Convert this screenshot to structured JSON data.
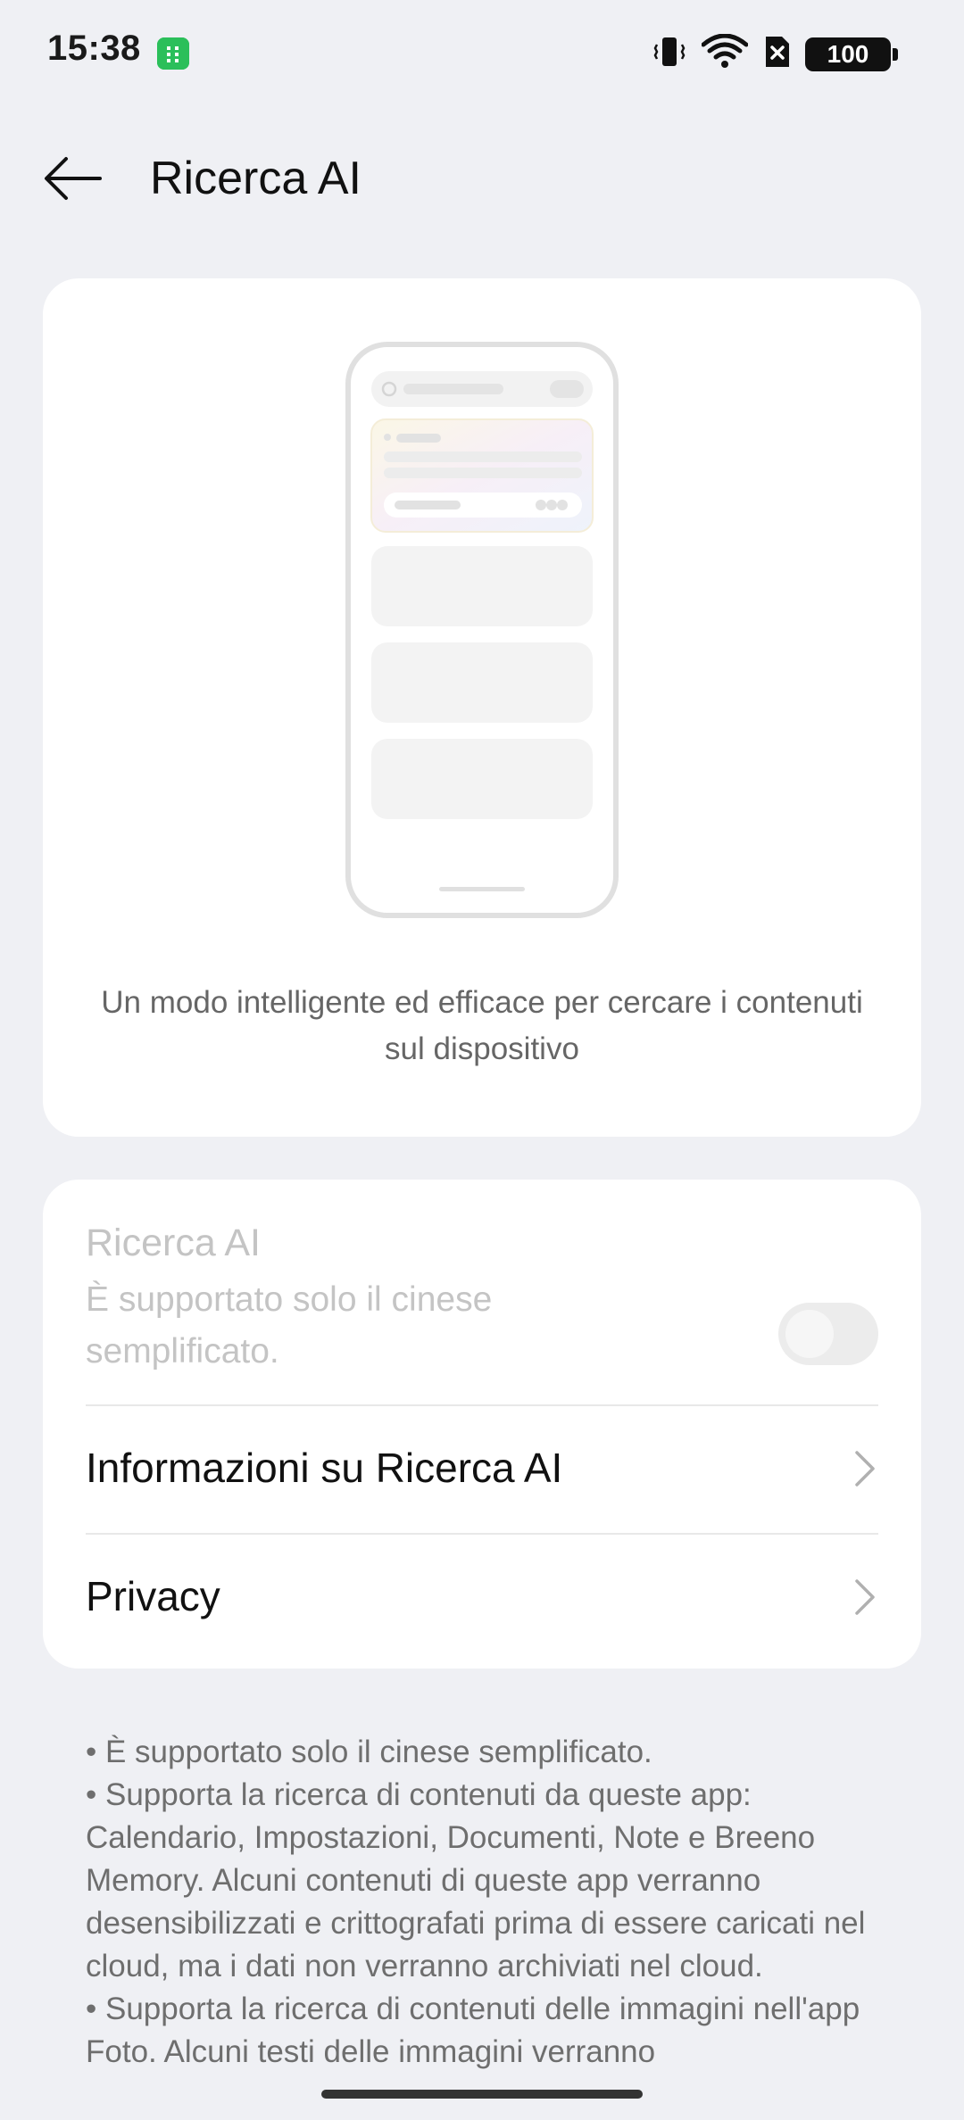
{
  "status_bar": {
    "time": "15:38",
    "battery": "100",
    "icons": [
      "vibrate-icon",
      "wifi-icon",
      "sim-off-icon",
      "battery-icon"
    ]
  },
  "header": {
    "back_icon": "arrow-left-icon",
    "title": "Ricerca AI"
  },
  "intro": {
    "description": "Un modo intelligente ed efficace per cercare i contenuti sul dispositivo"
  },
  "settings": {
    "ai_search": {
      "title": "Ricerca AI",
      "subtitle": "È supportato solo il cinese semplificato.",
      "enabled": false,
      "disabled": true
    },
    "rows": [
      {
        "label": "Informazioni su Ricerca AI",
        "icon": "chevron-right-icon"
      },
      {
        "label": "Privacy",
        "icon": "chevron-right-icon"
      }
    ]
  },
  "notes": [
    "• È supportato solo il cinese semplificato.",
    "• Supporta la ricerca di contenuti da queste app: Calendario, Impostazioni, Documenti, Note e Breeno Memory. Alcuni contenuti di queste app verranno desensibilizzati e crittografati prima di essere caricati nel cloud, ma i dati non verranno archiviati nel cloud.",
    "• Supporta la ricerca di contenuti delle immagini nell'app Foto. Alcuni testi delle immagini verranno"
  ],
  "colors": {
    "background": "#eff0f4",
    "card": "#ffffff",
    "disabled_text": "#c4c4c4",
    "status_app_icon": "#2bbf5a"
  }
}
